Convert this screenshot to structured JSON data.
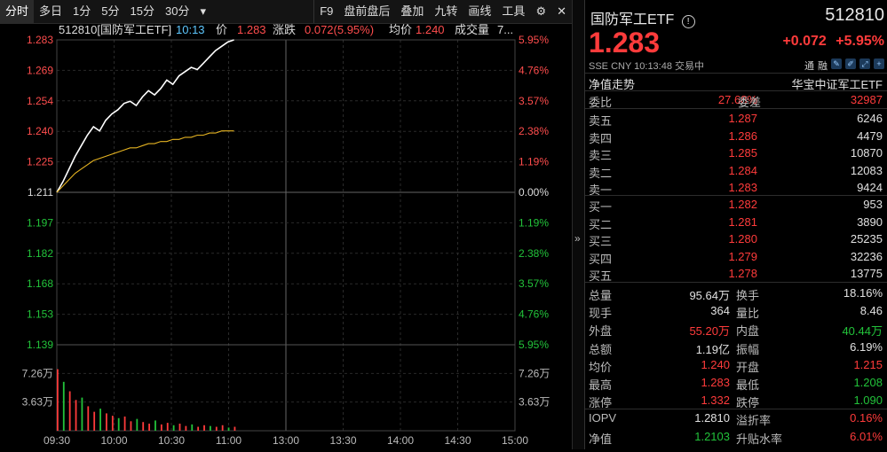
{
  "toolbar": {
    "left": [
      "分时",
      "多日",
      "1分",
      "5分",
      "15分",
      "30分",
      "▾"
    ],
    "right": [
      "F9",
      "盘前盘后",
      "叠加",
      "九转",
      "画线",
      "工具",
      "⚙",
      "✕"
    ]
  },
  "chart_header": {
    "code_name": "512810[国防军工ETF]",
    "time": "10:13",
    "price_label": "价",
    "price": "1.283",
    "change_label": "涨跌",
    "change": "0.072(5.95%)",
    "avg_label": "均价",
    "avg": "1.240",
    "vol_label": "成交量",
    "vol": "7..."
  },
  "chart_data": {
    "type": "line",
    "y_ticks_left": [
      "1.283",
      "1.269",
      "1.254",
      "1.240",
      "1.225",
      "1.211",
      "1.197",
      "1.182",
      "1.168",
      "1.153",
      "1.139"
    ],
    "y_ticks_right": [
      "5.95%",
      "4.76%",
      "3.57%",
      "2.38%",
      "1.19%",
      "0.00%",
      "1.19%",
      "2.38%",
      "3.57%",
      "4.76%",
      "5.95%"
    ],
    "vol_ticks": [
      "7.26万",
      "3.63万"
    ],
    "x_ticks": [
      "09:30",
      "10:00",
      "10:30",
      "11:00",
      "13:00",
      "13:30",
      "14:00",
      "14:30",
      "15:00"
    ],
    "ylim": [
      1.139,
      1.283
    ],
    "prev_close": 1.211,
    "series": [
      {
        "values": [
          1.211,
          1.216,
          1.222,
          1.228,
          1.233,
          1.238,
          1.242,
          1.24,
          1.245,
          1.248,
          1.25,
          1.253,
          1.254,
          1.252,
          1.256,
          1.259,
          1.257,
          1.26,
          1.264,
          1.262,
          1.266,
          1.268,
          1.27,
          1.269,
          1.272,
          1.275,
          1.278,
          1.28,
          1.282,
          1.283
        ]
      },
      {
        "values": [
          1.211,
          1.214,
          1.217,
          1.22,
          1.222,
          1.224,
          1.226,
          1.227,
          1.228,
          1.229,
          1.23,
          1.231,
          1.232,
          1.232,
          1.233,
          1.234,
          1.234,
          1.235,
          1.235,
          1.236,
          1.236,
          1.237,
          1.237,
          1.238,
          1.238,
          1.239,
          1.239,
          1.24,
          1.24,
          1.24
        ]
      }
    ],
    "volume": [
      7.8,
      6.2,
      5.0,
      3.9,
      4.2,
      3.1,
      2.4,
      2.8,
      2.2,
      1.9,
      1.6,
      1.8,
      1.2,
      1.5,
      1.1,
      0.9,
      1.3,
      0.8,
      1.0,
      0.7,
      0.9,
      0.6,
      0.8,
      0.5,
      0.7,
      0.6,
      0.5,
      0.7,
      0.4,
      0.5
    ]
  },
  "right_panel": {
    "title": "国防军工ETF",
    "info_icon": "info-circle-icon",
    "code": "512810",
    "price": "1.283",
    "change": "+0.072",
    "change_pct": "+5.95%",
    "meta": "SSE  CNY  10:13:48  交易中",
    "badges": [
      "通",
      "融"
    ],
    "tab_left": "净值走势",
    "tab_right": "华宝中证军工ETF",
    "weibi_label": "委比",
    "weibi": "27.68%",
    "weicha_label": "委差",
    "weicha": "32987",
    "asks": [
      {
        "label": "卖五",
        "price": "1.287",
        "vol": "6246"
      },
      {
        "label": "卖四",
        "price": "1.286",
        "vol": "4479"
      },
      {
        "label": "卖三",
        "price": "1.285",
        "vol": "10870"
      },
      {
        "label": "卖二",
        "price": "1.284",
        "vol": "12083"
      },
      {
        "label": "卖一",
        "price": "1.283",
        "vol": "9424"
      }
    ],
    "bids": [
      {
        "label": "买一",
        "price": "1.282",
        "vol": "953"
      },
      {
        "label": "买二",
        "price": "1.281",
        "vol": "3890"
      },
      {
        "label": "买三",
        "price": "1.280",
        "vol": "25235"
      },
      {
        "label": "买四",
        "price": "1.279",
        "vol": "32236"
      },
      {
        "label": "买五",
        "price": "1.278",
        "vol": "13775"
      }
    ],
    "stats": [
      {
        "l1": "总量",
        "v1": "95.64万",
        "c1": "white",
        "l2": "换手",
        "v2": "18.16%",
        "c2": "white"
      },
      {
        "l1": "现手",
        "v1": "364",
        "c1": "white",
        "l2": "量比",
        "v2": "8.46",
        "c2": "white"
      },
      {
        "l1": "外盘",
        "v1": "55.20万",
        "c1": "red",
        "l2": "内盘",
        "v2": "40.44万",
        "c2": "green"
      },
      {
        "l1": "总额",
        "v1": "1.19亿",
        "c1": "white",
        "l2": "振幅",
        "v2": "6.19%",
        "c2": "white"
      },
      {
        "l1": "均价",
        "v1": "1.240",
        "c1": "red",
        "l2": "开盘",
        "v2": "1.215",
        "c2": "red"
      },
      {
        "l1": "最高",
        "v1": "1.283",
        "c1": "red",
        "l2": "最低",
        "v2": "1.208",
        "c2": "green"
      },
      {
        "l1": "涨停",
        "v1": "1.332",
        "c1": "red",
        "l2": "跌停",
        "v2": "1.090",
        "c2": "green"
      }
    ],
    "stats2": [
      {
        "l1": "IOPV",
        "v1": "1.2810",
        "c1": "white",
        "l2": "溢折率",
        "v2": "0.16%",
        "c2": "red"
      },
      {
        "l1": "净值",
        "v1": "1.2103",
        "c1": "green",
        "l2": "升贴水率",
        "v2": "6.01%",
        "c2": "red"
      }
    ]
  }
}
